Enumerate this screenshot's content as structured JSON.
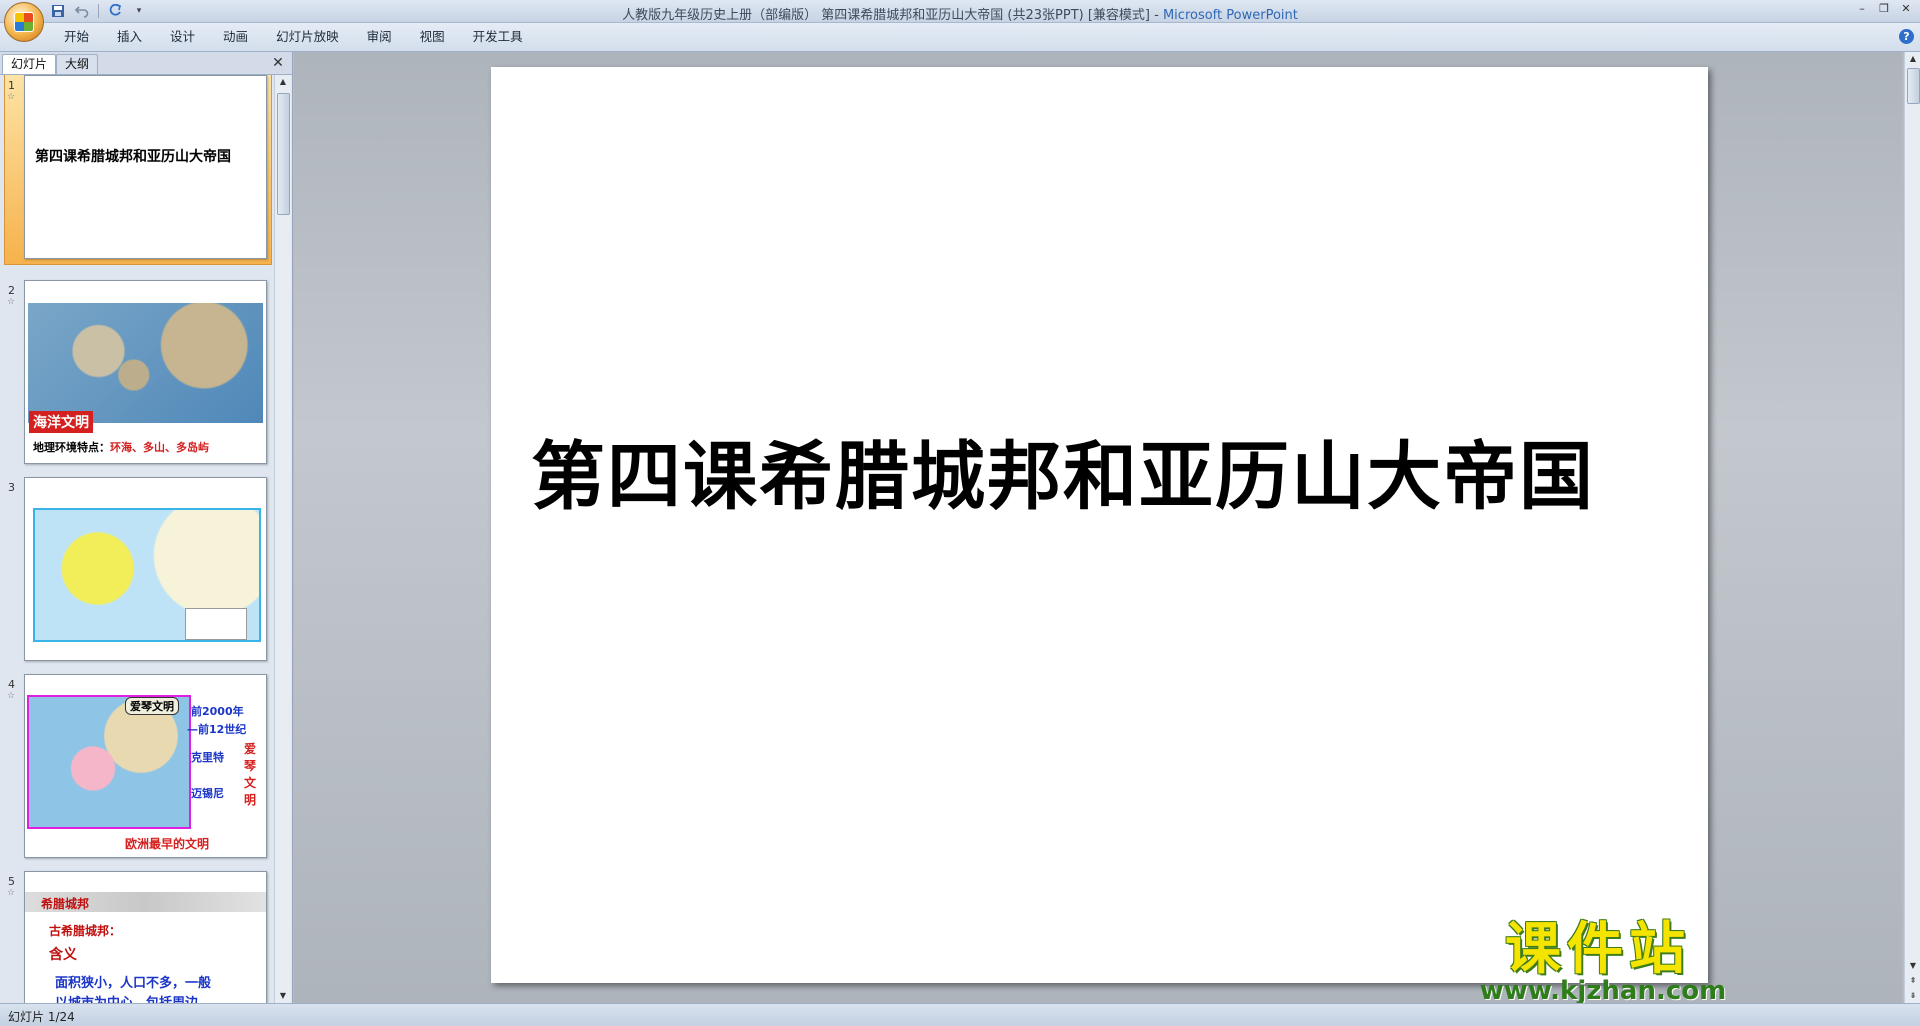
{
  "window": {
    "title_doc": "人教版九年级历史上册（部编版） 第四课希腊城邦和亚历山大帝国 (共23张PPT) [兼容模式] - ",
    "title_app": "Microsoft PowerPoint"
  },
  "ribbon": {
    "tabs": [
      "开始",
      "插入",
      "设计",
      "动画",
      "幻灯片放映",
      "审阅",
      "视图",
      "开发工具"
    ]
  },
  "pane": {
    "tab_slides": "幻灯片",
    "tab_outline": "大纲"
  },
  "thumbnails": [
    {
      "num": "1",
      "title": "第四课希腊城邦和亚历山大帝国"
    },
    {
      "num": "2",
      "label": "海洋文明",
      "caption_prefix": "地理环境特点：",
      "caption_value": "环海、多山、多岛屿"
    },
    {
      "num": "3"
    },
    {
      "num": "4",
      "map_title": "爱琴文明",
      "side": [
        "前2000年",
        "—前12世纪",
        "克里特",
        "迈锡尼"
      ],
      "vertical": "爱琴文明",
      "bottom": "欧洲最早的文明"
    },
    {
      "num": "5",
      "banner": "希腊城邦",
      "line1": "古希腊城邦：",
      "line2": "含义",
      "line3": "面积狭小，人口不多，一般",
      "line4": "以城市为中心，包括周边"
    }
  ],
  "slide": {
    "title": "第四课希腊城邦和亚历山大帝国"
  },
  "watermark": {
    "main": "课件站",
    "url": "www.kjzhan.com"
  },
  "status": {
    "text": "幻灯片 1/24"
  }
}
